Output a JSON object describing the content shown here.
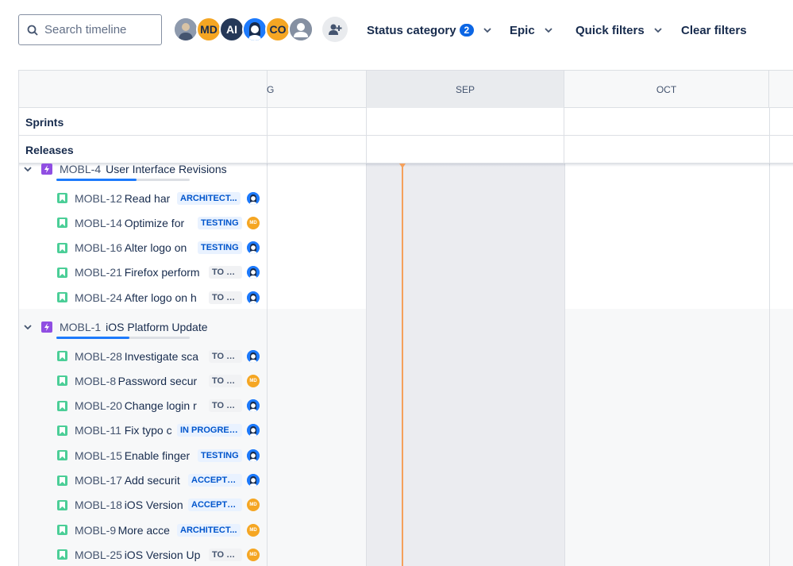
{
  "toolbar": {
    "search_placeholder": "Search timeline",
    "avatars": [
      {
        "type": "photo",
        "initials": "",
        "color": "#8e9aad"
      },
      {
        "type": "initials",
        "initials": "MD",
        "color": "#f5a623"
      },
      {
        "type": "initials",
        "initials": "AI",
        "color": "#253858"
      },
      {
        "type": "face",
        "initials": "",
        "color": "#1d7afc"
      },
      {
        "type": "initials",
        "initials": "CO",
        "color": "#f5a623"
      },
      {
        "type": "generic",
        "initials": "",
        "color": "#8590a2"
      }
    ],
    "status_category_label": "Status category",
    "status_category_count": "2",
    "epic_label": "Epic",
    "quick_filters_label": "Quick filters",
    "clear_filters_label": "Clear filters"
  },
  "timeline": {
    "months": [
      "G",
      "SEP",
      "OCT"
    ],
    "sprints_label": "Sprints",
    "releases_label": "Releases",
    "epics": [
      {
        "key": "MOBL-4",
        "title": "User Interface Revisions",
        "progress": 0.6,
        "issues": [
          {
            "key": "MOBL-12",
            "title": "Read har",
            "status": "ARCHITECT...",
            "status_color": "blue",
            "assignee": "face"
          },
          {
            "key": "MOBL-14",
            "title": "Optimize for",
            "status": "TESTING",
            "status_color": "blue",
            "assignee": "MD"
          },
          {
            "key": "MOBL-16",
            "title": "Alter logo on",
            "status": "TESTING",
            "status_color": "blue",
            "assignee": "face"
          },
          {
            "key": "MOBL-21",
            "title": "Firefox perform",
            "status": "TO DO",
            "status_color": "grey",
            "assignee": "face"
          },
          {
            "key": "MOBL-24",
            "title": "After logo on h",
            "status": "TO DO",
            "status_color": "grey",
            "assignee": "face"
          }
        ]
      },
      {
        "key": "MOBL-1",
        "title": "iOS Platform Update",
        "progress": 0.55,
        "issues": [
          {
            "key": "MOBL-28",
            "title": "Investigate sca",
            "status": "TO DO",
            "status_color": "grey",
            "assignee": "face"
          },
          {
            "key": "MOBL-8",
            "title": "Password secur",
            "status": "TO DO",
            "status_color": "grey",
            "assignee": "MD"
          },
          {
            "key": "MOBL-20",
            "title": "Change login r",
            "status": "TO DO",
            "status_color": "grey",
            "assignee": "face"
          },
          {
            "key": "MOBL-11",
            "title": "Fix typo c",
            "status": "IN PROGRESS",
            "status_color": "blue",
            "assignee": "face"
          },
          {
            "key": "MOBL-15",
            "title": "Enable finger",
            "status": "TESTING",
            "status_color": "blue",
            "assignee": "face"
          },
          {
            "key": "MOBL-17",
            "title": "Add securit",
            "status": "ACCEPTED",
            "status_color": "blue",
            "assignee": "face"
          },
          {
            "key": "MOBL-18",
            "title": "iOS Version",
            "status": "ACCEPTED",
            "status_color": "blue",
            "assignee": "MD"
          },
          {
            "key": "MOBL-9",
            "title": "More acce",
            "status": "ARCHITECT...",
            "status_color": "blue",
            "assignee": "MD"
          },
          {
            "key": "MOBL-25",
            "title": "iOS Version Up",
            "status": "TO DO",
            "status_color": "grey",
            "assignee": "MD"
          }
        ]
      }
    ]
  }
}
